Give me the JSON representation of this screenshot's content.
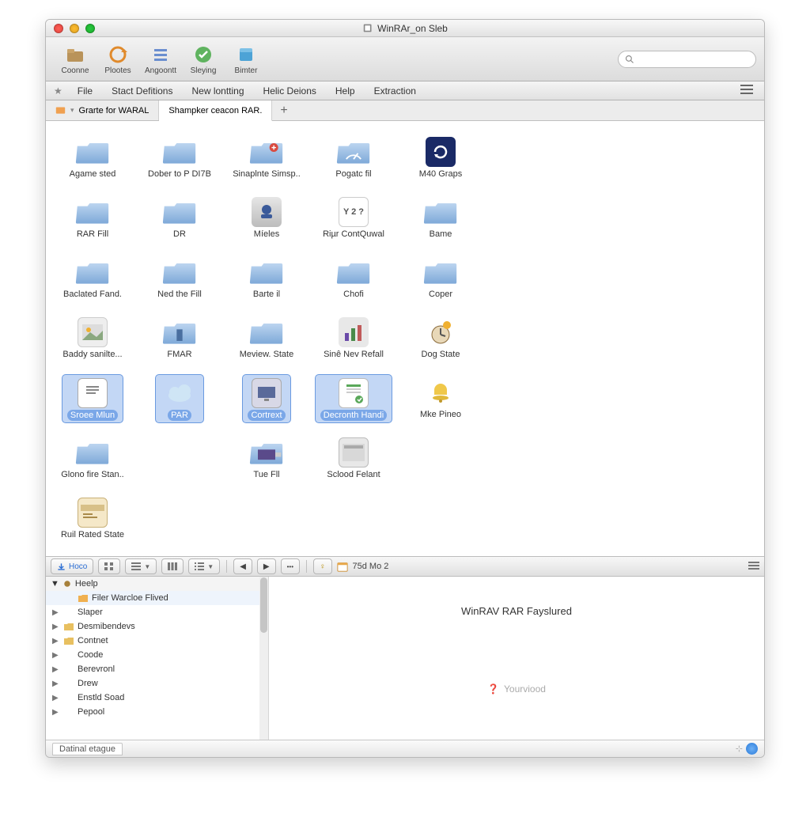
{
  "window": {
    "title": "WinRAr_on Sleb"
  },
  "toolbar": [
    {
      "label": "Coonne"
    },
    {
      "label": "Plootes"
    },
    {
      "label": "Angoontt"
    },
    {
      "label": "Sleying"
    },
    {
      "label": "Bimter"
    }
  ],
  "search": {
    "placeholder": ""
  },
  "menu": {
    "items": [
      "File",
      "Stact Defitions",
      "New lontting",
      "Helic Deions",
      "Help",
      "Extraction"
    ]
  },
  "tabs": [
    {
      "label": "Grarte for WARAL",
      "active": false
    },
    {
      "label": "Shampker ceacon RAR.",
      "active": true
    }
  ],
  "files": [
    {
      "label": "Agame sted",
      "kind": "folder",
      "selected": false
    },
    {
      "label": "Dober to P DI7B",
      "kind": "folder",
      "selected": false
    },
    {
      "label": "Sinaplnte Simsp..",
      "kind": "folder-plus",
      "selected": false
    },
    {
      "label": "Pogatc fil",
      "kind": "folder-meter",
      "selected": false
    },
    {
      "label": "M40 Graps",
      "kind": "app-cycle",
      "selected": false
    },
    {
      "label": "RAR Fill",
      "kind": "folder",
      "selected": false
    },
    {
      "label": "DR",
      "kind": "folder",
      "selected": false
    },
    {
      "label": "Míeles",
      "kind": "app-stamp",
      "selected": false
    },
    {
      "label": "Riµr ContQuwal",
      "kind": "app-date",
      "selected": false
    },
    {
      "label": "Bame",
      "kind": "folder",
      "selected": false
    },
    {
      "label": "Baclated Fand.",
      "kind": "folder",
      "selected": false
    },
    {
      "label": "Ned the Fill",
      "kind": "folder",
      "selected": false
    },
    {
      "label": "Barte il",
      "kind": "folder",
      "selected": false
    },
    {
      "label": "Chofi",
      "kind": "folder",
      "selected": false
    },
    {
      "label": "Coper",
      "kind": "folder",
      "selected": false
    },
    {
      "label": "Baddy sanilte...",
      "kind": "app-photo",
      "selected": false
    },
    {
      "label": "FMAR",
      "kind": "folder-arch",
      "selected": false
    },
    {
      "label": "Meview. State",
      "kind": "folder",
      "selected": false
    },
    {
      "label": "Sinê Nev Refall",
      "kind": "app-bars",
      "selected": false
    },
    {
      "label": "Dog State",
      "kind": "app-clock",
      "selected": false
    },
    {
      "label": "Sroee Mlun",
      "kind": "app-doc",
      "selected": true
    },
    {
      "label": "PAR",
      "kind": "app-cloud",
      "selected": true
    },
    {
      "label": "Cortrext",
      "kind": "app-screen",
      "selected": true
    },
    {
      "label": "Decronth Handi",
      "kind": "app-sheet",
      "selected": true
    },
    {
      "label": "Mke Pineo",
      "kind": "app-bell",
      "selected": false
    },
    {
      "label": "Glono fire Stan..",
      "kind": "folder",
      "selected": false
    },
    {
      "label": "",
      "kind": "spacer",
      "selected": false
    },
    {
      "label": "Tue Fll",
      "kind": "folder-media",
      "selected": false
    },
    {
      "label": "Sclood Felant",
      "kind": "app-window",
      "selected": false
    },
    {
      "label": "",
      "kind": "spacer",
      "selected": false
    },
    {
      "label": "Ruil Rated State",
      "kind": "app-card",
      "selected": false
    }
  ],
  "lower": {
    "home": "Hoco",
    "date": "75d Mo 2"
  },
  "tree": {
    "header": "Heelp",
    "items": [
      {
        "label": "Filer Warcloe Flived",
        "icon": "folder",
        "indent": true
      },
      {
        "label": "Slaper"
      },
      {
        "label": "Desmibendevs",
        "icon": "folder-y"
      },
      {
        "label": "Contnet",
        "icon": "folder-y"
      },
      {
        "label": "Coode"
      },
      {
        "label": "Berevronl"
      },
      {
        "label": "Drew"
      },
      {
        "label": "Enstld Soad"
      },
      {
        "label": "Pepool"
      }
    ]
  },
  "preview": {
    "title": "WinRAV RAR Fayslured",
    "placeholder": "Yourviood"
  },
  "status": {
    "label": "Datinal etague"
  }
}
